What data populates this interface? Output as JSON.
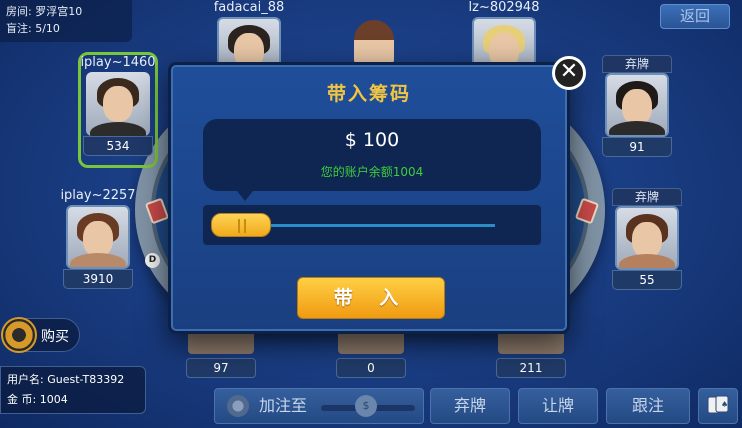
{
  "room": {
    "room_label": "房间: 罗浮宫10",
    "blinds_label": "盲注: 5/10"
  },
  "back_label": "返回",
  "seats": [
    {
      "name": "iplay~1460",
      "chips": "534"
    },
    {
      "name": "fadacai_88",
      "chips": ""
    },
    {
      "name": "lz~802948",
      "chips": ""
    },
    {
      "name": "iplay~2257",
      "chips": "3910"
    },
    {
      "name": "",
      "chips": "91",
      "tag": "弃牌"
    },
    {
      "name": "",
      "chips": "55",
      "tag": "弃牌"
    },
    {
      "name": "",
      "chips": "97"
    },
    {
      "name": "",
      "chips": "0"
    },
    {
      "name": "",
      "chips": "211"
    }
  ],
  "dealer_label": "D",
  "buy_label": "购买",
  "user": {
    "username_label": "用户名:",
    "username": "Guest-T83392",
    "gold_label": "金 币:",
    "gold": "1004"
  },
  "actions": {
    "raise_label": "加注至",
    "raise_knob": "$",
    "fold_label": "弃牌",
    "check_label": "让牌",
    "call_label": "跟注"
  },
  "modal": {
    "title": "带入筹码",
    "close_symbol": "✕",
    "amount": "$ 100",
    "balance": "您的账户余额1004",
    "slider_value": 0.0,
    "confirm_label": "带 入"
  }
}
